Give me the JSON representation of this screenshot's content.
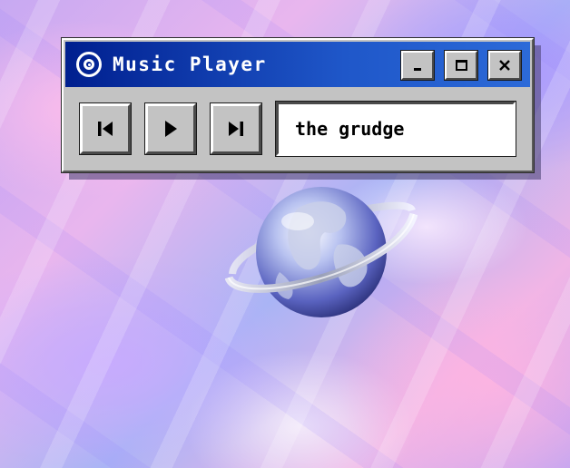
{
  "window": {
    "title": "Music Player",
    "controls": {
      "minimize": "minimize-icon",
      "maximize": "maximize-icon",
      "close": "close-icon"
    }
  },
  "player": {
    "buttons": [
      "previous-track-icon",
      "play-icon",
      "next-track-icon"
    ],
    "now_playing": "the grudge"
  },
  "colors": {
    "titlebar_start": "#001f8f",
    "titlebar_end": "#2c6ad8",
    "window_face": "#c3c3c3",
    "background_tint": "#c7a9f2"
  }
}
